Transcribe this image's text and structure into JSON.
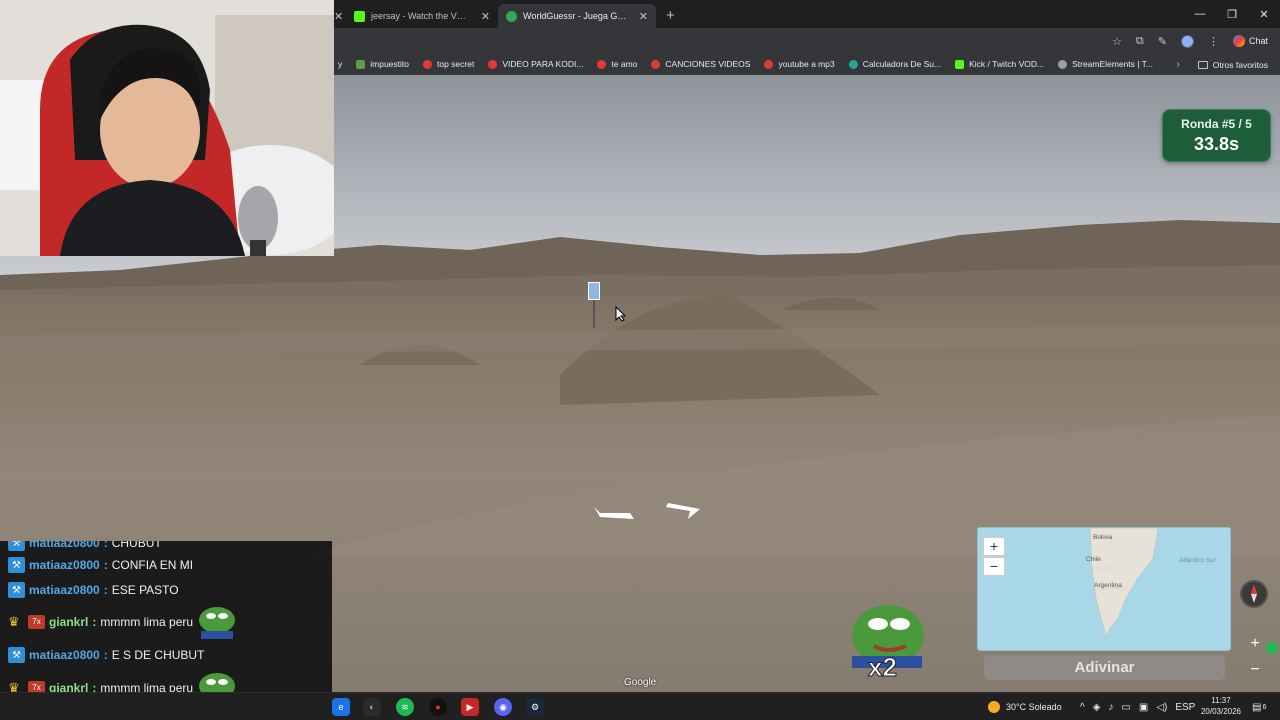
{
  "browser": {
    "tabs": [
      {
        "label": "jeersay - Watch the VOD on Kick",
        "color": "#53fc18",
        "active": false
      },
      {
        "label": "WorldGuessr - Juega GeoGuessr g",
        "color": "#34a853",
        "active": true
      }
    ],
    "new_tab": "+",
    "window_controls": {
      "minimize": "—",
      "maximize": "❐",
      "close": "✕"
    },
    "chat_label": "Chat",
    "bookmarks": [
      {
        "label": "y",
        "color": "#35363a"
      },
      {
        "label": "impuestito",
        "color": "#5f9e44"
      },
      {
        "label": "top secret",
        "color": "#e53935"
      },
      {
        "label": "VIDEO PARA KODI...",
        "color": "#e53935"
      },
      {
        "label": "te amo",
        "color": "#e53935"
      },
      {
        "label": "CANCIONES VIDEOS",
        "color": "#e53935"
      },
      {
        "label": "youtube a mp3",
        "color": "#e53935"
      },
      {
        "label": "Calculadora De Su...",
        "color": "#26a69a"
      },
      {
        "label": "Kick / Twitch VOD...",
        "color": "#53fc18"
      },
      {
        "label": "StreamElements | T...",
        "color": "#9e9e9e"
      }
    ],
    "bookmarks_more": "›",
    "other_bookmarks": "Otros favoritos"
  },
  "game": {
    "round_label": "Ronda #5 / 5",
    "timer": "33.8s",
    "guess_button": "Adivinar",
    "map_zoom_in": "+",
    "map_zoom_out": "−",
    "sv_zoom_in": "+",
    "sv_zoom_out": "−",
    "map_labels": {
      "bolivia": "Bolivia",
      "chile": "Chile",
      "argentina": "Argentina",
      "atlantic": "Atlántico Sur"
    },
    "attribution": "Google",
    "emote_multiplier": "x2"
  },
  "chat": {
    "messages": [
      {
        "user": "matiaaz0800",
        "text": "CHUBUT",
        "badges": [
          "kick"
        ],
        "emote": false
      },
      {
        "user": "matiaaz0800",
        "text": "CONFIA EN MI",
        "badges": [
          "kick"
        ],
        "emote": false
      },
      {
        "user": "matiaaz0800",
        "text": "ESE PASTO",
        "badges": [
          "kick"
        ],
        "emote": false
      },
      {
        "user": "giankrl",
        "text": "mmmm lima peru",
        "badges": [
          "crown",
          "7x"
        ],
        "emote": true
      },
      {
        "user": "matiaaz0800",
        "text": "E S DE CHUBUT",
        "badges": [
          "kick"
        ],
        "emote": false
      },
      {
        "user": "giankrl",
        "text": "mmmm lima peru",
        "badges": [
          "crown",
          "7x"
        ],
        "emote": true
      }
    ],
    "badge_7_text": "7x"
  },
  "taskbar": {
    "weather": "30°C Soleado",
    "language": "ESP",
    "time": "11:37",
    "date": "20/03/2026",
    "notification_count": "6"
  }
}
